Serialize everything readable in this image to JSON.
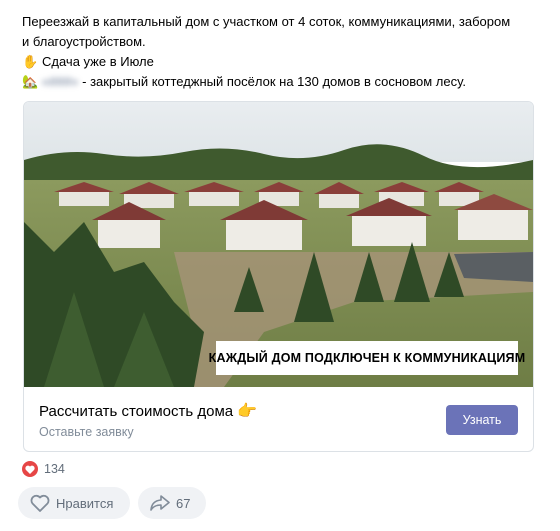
{
  "post": {
    "line1": "Переезжай в капитальный дом с участком от 4 соток, коммуникациями, забором",
    "line2": "и благоустройством.",
    "line3_emoji": "hand-waving-emoji",
    "line3_text": "Сдача уже в Июле",
    "line4_emoji": "house-emoji",
    "line4_blurred_name": "«###»",
    "line4_text": "- закрытый коттеджный посёлок на 130 домов в сосновом лесу."
  },
  "ad_card": {
    "video_caption": "КАЖДЫЙ ДОМ ПОДКЛЮЧЕН К КОММУНИКАЦИЯМ",
    "title": "Рассчитать стоимость дома",
    "title_icon": "pointing-hand-icon",
    "subtitle": "Оставьте заявку",
    "button_label": "Узнать"
  },
  "reactions": {
    "like_count": "134",
    "like_label": "Нравится",
    "share_count": "67"
  },
  "colors": {
    "accent_button": "#6b73b8",
    "heart": "#e64646",
    "muted_text": "#818c99",
    "action_bg": "#f0f2f5"
  }
}
